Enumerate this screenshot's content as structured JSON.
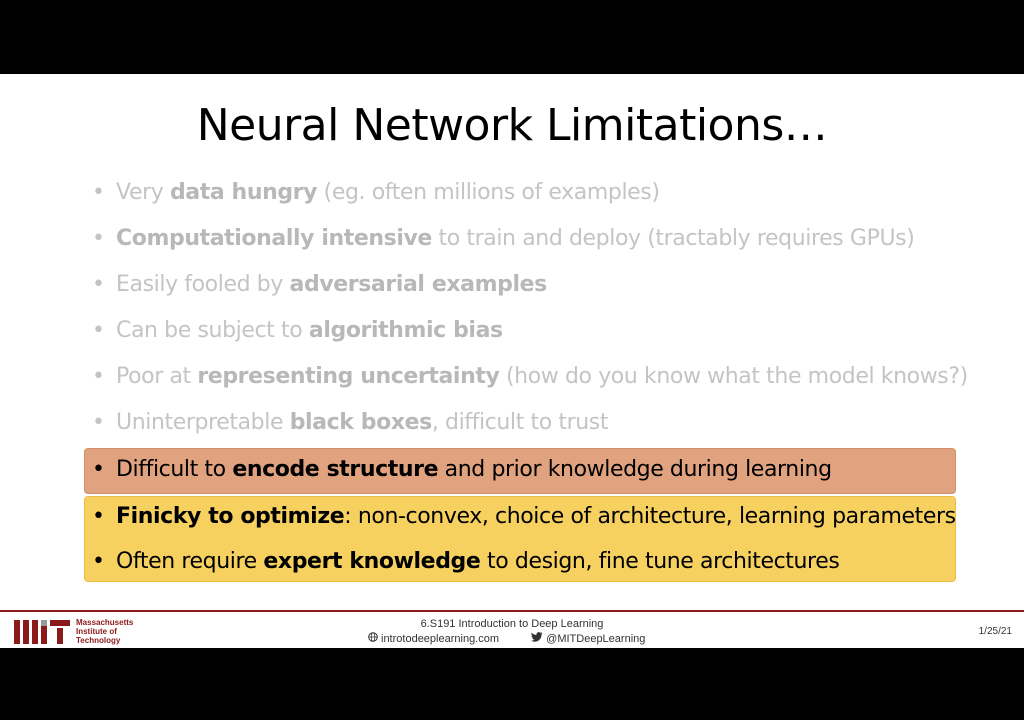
{
  "slide": {
    "title": "Neural Network Limitations…",
    "bullets": [
      {
        "pre": "Very ",
        "bold": "data hungry",
        "post": " (eg. often millions of examples)"
      },
      {
        "pre": "",
        "bold": "Computationally intensive",
        "post": " to train and deploy (tractably requires GPUs)"
      },
      {
        "pre": "Easily fooled by ",
        "bold": "adversarial examples",
        "post": ""
      },
      {
        "pre": "Can be subject to ",
        "bold": "algorithmic bias",
        "post": ""
      },
      {
        "pre": "Poor at ",
        "bold": "representing uncertainty",
        "post": " (how do you know what the model knows?)"
      },
      {
        "pre": "Uninterpretable ",
        "bold": "black boxes",
        "post": ", difficult to trust"
      },
      {
        "pre": "Difficult to ",
        "bold": "encode structure",
        "post": " and prior knowledge during learning"
      },
      {
        "pre": "",
        "bold": "Finicky to optimize",
        "post": ": non-convex, choice of architecture, learning parameters"
      },
      {
        "pre": "Often require ",
        "bold": "expert knowledge",
        "post": " to design, fine tune architectures"
      }
    ],
    "bullet_char": "•"
  },
  "footer": {
    "institution": [
      "Massachusetts",
      "Institute of",
      "Technology"
    ],
    "course": "6.S191 Introduction to Deep Learning",
    "website": "introtodeeplearning.com",
    "twitter": "@MITDeepLearning",
    "date": "1/25/21"
  },
  "colors": {
    "highlight_orange": "#e0a27f",
    "highlight_yellow": "#f7d160",
    "mit_red": "#8b1a1a"
  }
}
